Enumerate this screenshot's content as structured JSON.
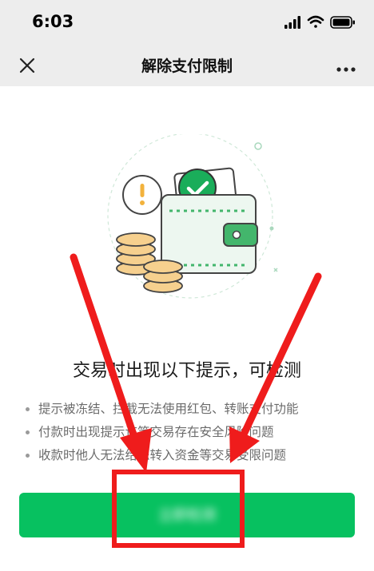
{
  "status_bar": {
    "time": "6:03",
    "icons": [
      "signal-icon",
      "wifi-icon",
      "battery-icon"
    ]
  },
  "nav": {
    "title": "解除支付限制",
    "left_icon": "close-icon",
    "right_icon": "more-icon"
  },
  "content": {
    "heading": "交易时出现以下提示，可检测",
    "tips": [
      "提示被冻结、拦截无法使用红包、转账支付功能",
      "付款时出现提示该笔交易存在安全风险问题",
      "收款时他人无法给您转入资金等交易受限问题"
    ],
    "action_button": {
      "label": "立即检测"
    }
  },
  "colors": {
    "accent": "#07c160",
    "annotation": "#ef1c1c",
    "bar_background": "#ededed"
  }
}
